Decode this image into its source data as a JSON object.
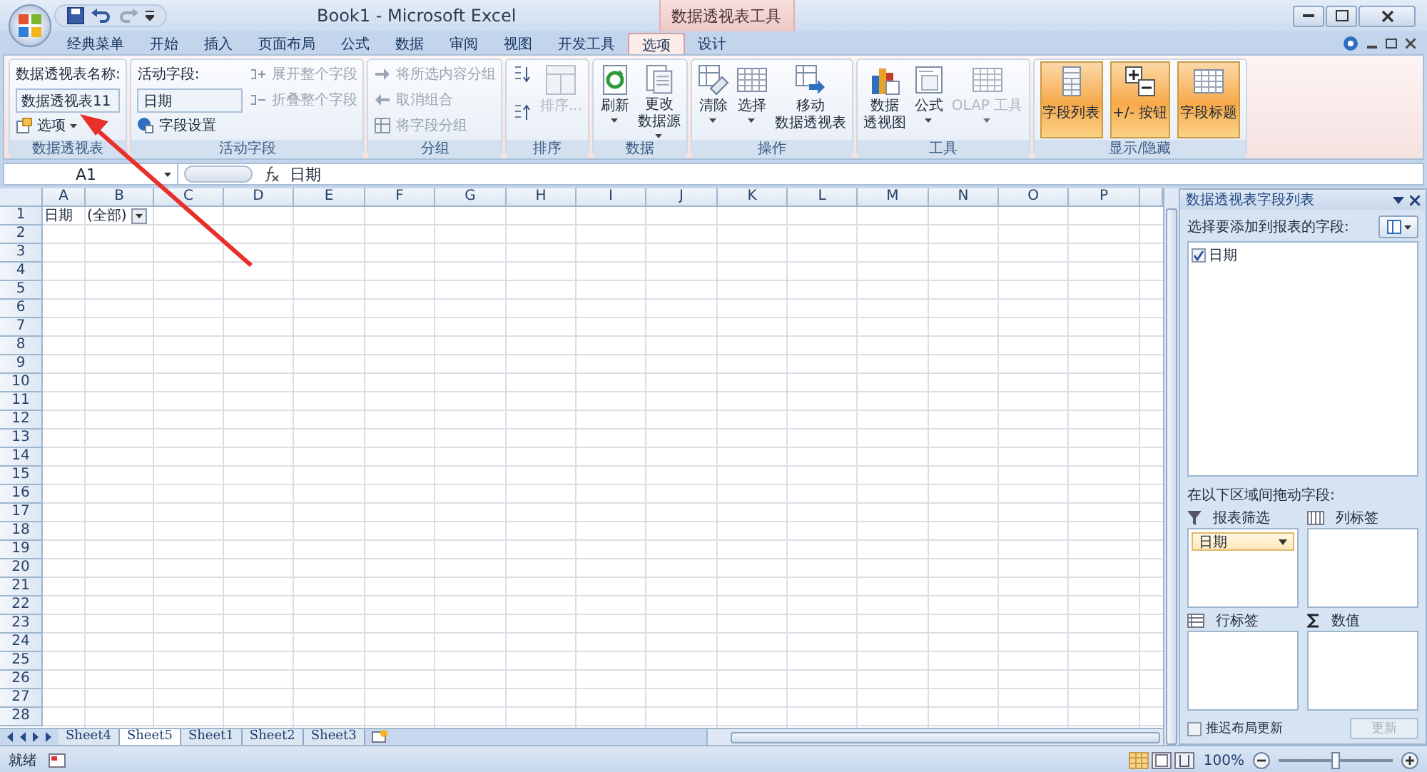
{
  "window": {
    "title": "Book1 - Microsoft Excel",
    "context_label": "数据透视表工具"
  },
  "tabs": [
    {
      "label": "经典菜单",
      "selected": false
    },
    {
      "label": "开始",
      "selected": false
    },
    {
      "label": "插入",
      "selected": false
    },
    {
      "label": "页面布局",
      "selected": false
    },
    {
      "label": "公式",
      "selected": false
    },
    {
      "label": "数据",
      "selected": false
    },
    {
      "label": "审阅",
      "selected": false
    },
    {
      "label": "视图",
      "selected": false
    },
    {
      "label": "开发工具",
      "selected": false
    },
    {
      "label": "选项",
      "selected": true
    },
    {
      "label": "设计",
      "selected": false
    }
  ],
  "ribbon": {
    "groups": [
      {
        "label": "数据透视表",
        "items": [
          {
            "kind": "label",
            "text": "数据透视表名称:"
          },
          {
            "kind": "field",
            "value": "数据透视表11"
          },
          {
            "kind": "small",
            "label": "选项",
            "dropdown": true,
            "disabled": false
          }
        ]
      },
      {
        "label": "活动字段",
        "items": [
          {
            "kind": "label",
            "text": "活动字段:"
          },
          {
            "kind": "field",
            "value": "日期"
          },
          {
            "kind": "small",
            "label": "字段设置",
            "dropdown": false,
            "disabled": false
          },
          {
            "kind": "small",
            "label": "展开整个字段",
            "dropdown": false,
            "disabled": true
          },
          {
            "kind": "small",
            "label": "折叠整个字段",
            "dropdown": false,
            "disabled": true
          }
        ]
      },
      {
        "label": "分组",
        "items": [
          {
            "kind": "small",
            "label": "将所选内容分组",
            "dropdown": false,
            "disabled": true
          },
          {
            "kind": "small",
            "label": "取消组合",
            "dropdown": false,
            "disabled": true
          },
          {
            "kind": "small",
            "label": "将字段分组",
            "dropdown": false,
            "disabled": true
          }
        ]
      },
      {
        "label": "排序",
        "items": [
          {
            "kind": "sort_asc",
            "disabled": false
          },
          {
            "kind": "sort_desc",
            "disabled": false
          },
          {
            "kind": "large",
            "lines": [
              "排序..."
            ],
            "dropdown": false,
            "disabled": true
          }
        ]
      },
      {
        "label": "数据",
        "items": [
          {
            "kind": "large",
            "lines": [
              "刷新"
            ],
            "dropdown": true,
            "disabled": false
          },
          {
            "kind": "large",
            "lines": [
              "更改",
              "数据源"
            ],
            "dropdown": true,
            "disabled": false
          }
        ]
      },
      {
        "label": "操作",
        "items": [
          {
            "kind": "large",
            "lines": [
              "清除"
            ],
            "dropdown": true,
            "disabled": false
          },
          {
            "kind": "large",
            "lines": [
              "选择"
            ],
            "dropdown": true,
            "disabled": false
          },
          {
            "kind": "large",
            "lines": [
              "移动",
              "数据透视表"
            ],
            "dropdown": false,
            "disabled": false
          }
        ]
      },
      {
        "label": "工具",
        "items": [
          {
            "kind": "large",
            "lines": [
              "数据",
              "透视图"
            ],
            "dropdown": false,
            "disabled": false
          },
          {
            "kind": "large",
            "lines": [
              "公式"
            ],
            "dropdown": true,
            "disabled": false
          },
          {
            "kind": "large",
            "lines": [
              "OLAP 工具"
            ],
            "dropdown": true,
            "disabled": true
          }
        ]
      },
      {
        "label": "显示/隐藏",
        "items": [
          {
            "kind": "toggle",
            "label": "字段列表",
            "on": true
          },
          {
            "kind": "toggle",
            "label": "+/- 按钮",
            "on": true
          },
          {
            "kind": "toggle",
            "label": "字段标题",
            "on": true
          }
        ]
      }
    ]
  },
  "formula_bar": {
    "name_box": "A1",
    "value": "日期"
  },
  "sheet": {
    "columns": [
      "A",
      "B",
      "C",
      "D",
      "E",
      "F",
      "G",
      "H",
      "I",
      "J",
      "K",
      "L",
      "M",
      "N",
      "O",
      "P"
    ],
    "rows": [
      {
        "header": "1",
        "cells": [
          {
            "text": "日期",
            "dropdown": false
          },
          {
            "text": "(全部)",
            "dropdown": true
          }
        ]
      },
      {
        "header": "2"
      },
      {
        "header": "3"
      },
      {
        "header": "4"
      },
      {
        "header": "5"
      },
      {
        "header": "6"
      },
      {
        "header": "7"
      },
      {
        "header": "8"
      },
      {
        "header": "9"
      },
      {
        "header": "10"
      },
      {
        "header": "11"
      },
      {
        "header": "12"
      },
      {
        "header": "13"
      },
      {
        "header": "14"
      },
      {
        "header": "15"
      },
      {
        "header": "16"
      },
      {
        "header": "17"
      },
      {
        "header": "18"
      },
      {
        "header": "19"
      },
      {
        "header": "20"
      },
      {
        "header": "21"
      },
      {
        "header": "22"
      },
      {
        "header": "23"
      },
      {
        "header": "24"
      },
      {
        "header": "25"
      },
      {
        "header": "26"
      },
      {
        "header": "27"
      },
      {
        "header": "28"
      }
    ]
  },
  "sheet_tabs": [
    {
      "label": "Sheet4",
      "selected": false
    },
    {
      "label": "Sheet5",
      "selected": true
    },
    {
      "label": "Sheet1",
      "selected": false
    },
    {
      "label": "Sheet2",
      "selected": false
    },
    {
      "label": "Sheet3",
      "selected": false
    }
  ],
  "field_panel": {
    "title": "数据透视表字段列表",
    "prompt": "选择要添加到报表的字段:",
    "fields": [
      {
        "label": "日期",
        "checked": true
      }
    ],
    "drag_prompt": "在以下区域间拖动字段:",
    "areas": [
      {
        "label": "报表筛选",
        "kind": "filter",
        "items": [
          "日期"
        ]
      },
      {
        "label": "列标签",
        "kind": "columns"
      },
      {
        "label": "行标签",
        "kind": "rows"
      },
      {
        "label": "数值",
        "kind": "values"
      }
    ],
    "defer_update": {
      "label": "推迟布局更新",
      "checked": false
    },
    "update_button": {
      "label": "更新",
      "disabled": true
    }
  },
  "status_bar": {
    "text": "就绪",
    "zoom": "100%",
    "zoom_slider": {
      "level": 0.5
    }
  }
}
